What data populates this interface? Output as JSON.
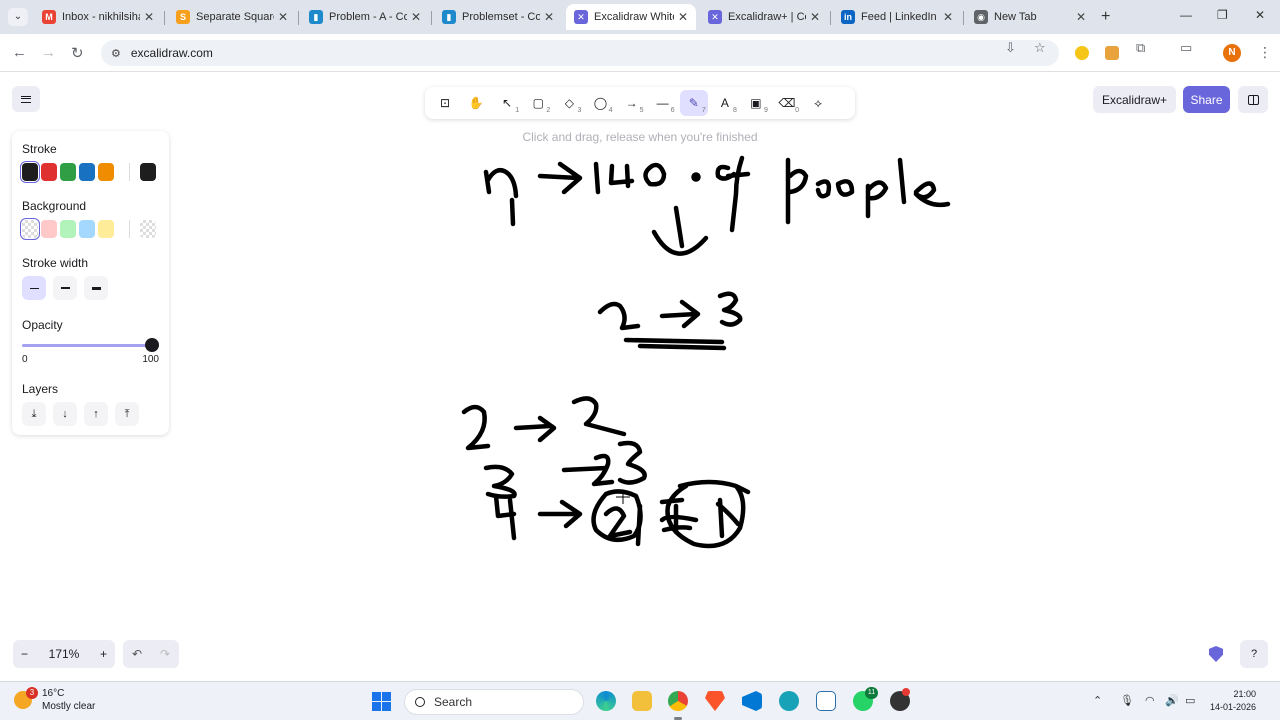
{
  "browser": {
    "tabs": [
      {
        "title": "Inbox - nikhilsiha",
        "icon": "gmail-icon",
        "color": "#ea4335",
        "glyph": "M"
      },
      {
        "title": "Separate Squares",
        "icon": "leetcode-icon",
        "color": "#f89f1b",
        "glyph": "S"
      },
      {
        "title": "Problem - A - Co",
        "icon": "codeforces-icon",
        "color": "#1f8acb",
        "glyph": "▮"
      },
      {
        "title": "Problemset - Co",
        "icon": "codeforces-icon",
        "color": "#1f8acb",
        "glyph": "▮"
      },
      {
        "title": "Excalidraw White",
        "icon": "excalidraw-icon",
        "color": "#6965db",
        "glyph": "✕",
        "active": true
      },
      {
        "title": "Excalidraw+ | Co",
        "icon": "excalidraw-icon",
        "color": "#6965db",
        "glyph": "✕"
      },
      {
        "title": "Feed | LinkedIn",
        "icon": "linkedin-icon",
        "color": "#0a66c2",
        "glyph": "in"
      },
      {
        "title": "New Tab",
        "icon": "chrome-icon",
        "color": "#5f6368",
        "glyph": "◉"
      }
    ],
    "url": "excalidraw.com",
    "profile_initial": "N"
  },
  "app": {
    "toolbar_hint": "Click and drag, release when you're finished",
    "tools": [
      {
        "name": "lock-icon",
        "glyph": "🔓",
        "key": ""
      },
      {
        "name": "hand-icon",
        "glyph": "✋",
        "key": ""
      },
      {
        "name": "selection-icon",
        "glyph": "↖",
        "key": "1"
      },
      {
        "name": "rectangle-icon",
        "glyph": "▢",
        "key": "2"
      },
      {
        "name": "diamond-icon",
        "glyph": "◇",
        "key": "3"
      },
      {
        "name": "ellipse-icon",
        "glyph": "◯",
        "key": "4"
      },
      {
        "name": "arrow-icon",
        "glyph": "→",
        "key": "5"
      },
      {
        "name": "line-icon",
        "glyph": "—",
        "key": "6"
      },
      {
        "name": "draw-icon",
        "glyph": "✎",
        "key": "7",
        "active": true
      },
      {
        "name": "text-icon",
        "glyph": "A",
        "key": "8"
      },
      {
        "name": "image-icon",
        "glyph": "🖼",
        "key": "9"
      },
      {
        "name": "eraser-icon",
        "glyph": "⌫",
        "key": "0"
      },
      {
        "name": "more-tools-icon",
        "glyph": "⬡",
        "key": ""
      }
    ],
    "excalidraw_plus_label": "Excalidraw+",
    "share_label": "Share",
    "props": {
      "stroke_label": "Stroke",
      "stroke_colors": [
        "#1e1e1e",
        "#e03131",
        "#2f9e44",
        "#1971c2",
        "#f08c00"
      ],
      "stroke_current": "#1e1e1e",
      "background_label": "Background",
      "background_colors": [
        "transparent",
        "#ffc9c9",
        "#b2f2bb",
        "#a5d8ff",
        "#ffec99"
      ],
      "stroke_width_label": "Stroke width",
      "opacity_label": "Opacity",
      "opacity_value": 100,
      "opacity_min_label": "0",
      "opacity_max_label": "100",
      "layers_label": "Layers"
    },
    "zoom": {
      "minus": "−",
      "value": "171%",
      "plus": "+"
    }
  },
  "taskbar": {
    "weather_temp": "16°C",
    "weather_desc": "Mostly clear",
    "weather_badge": "3",
    "search_label": "Search",
    "whatsapp_badge": "11",
    "time": "21:00",
    "date": "14-01-2026"
  }
}
